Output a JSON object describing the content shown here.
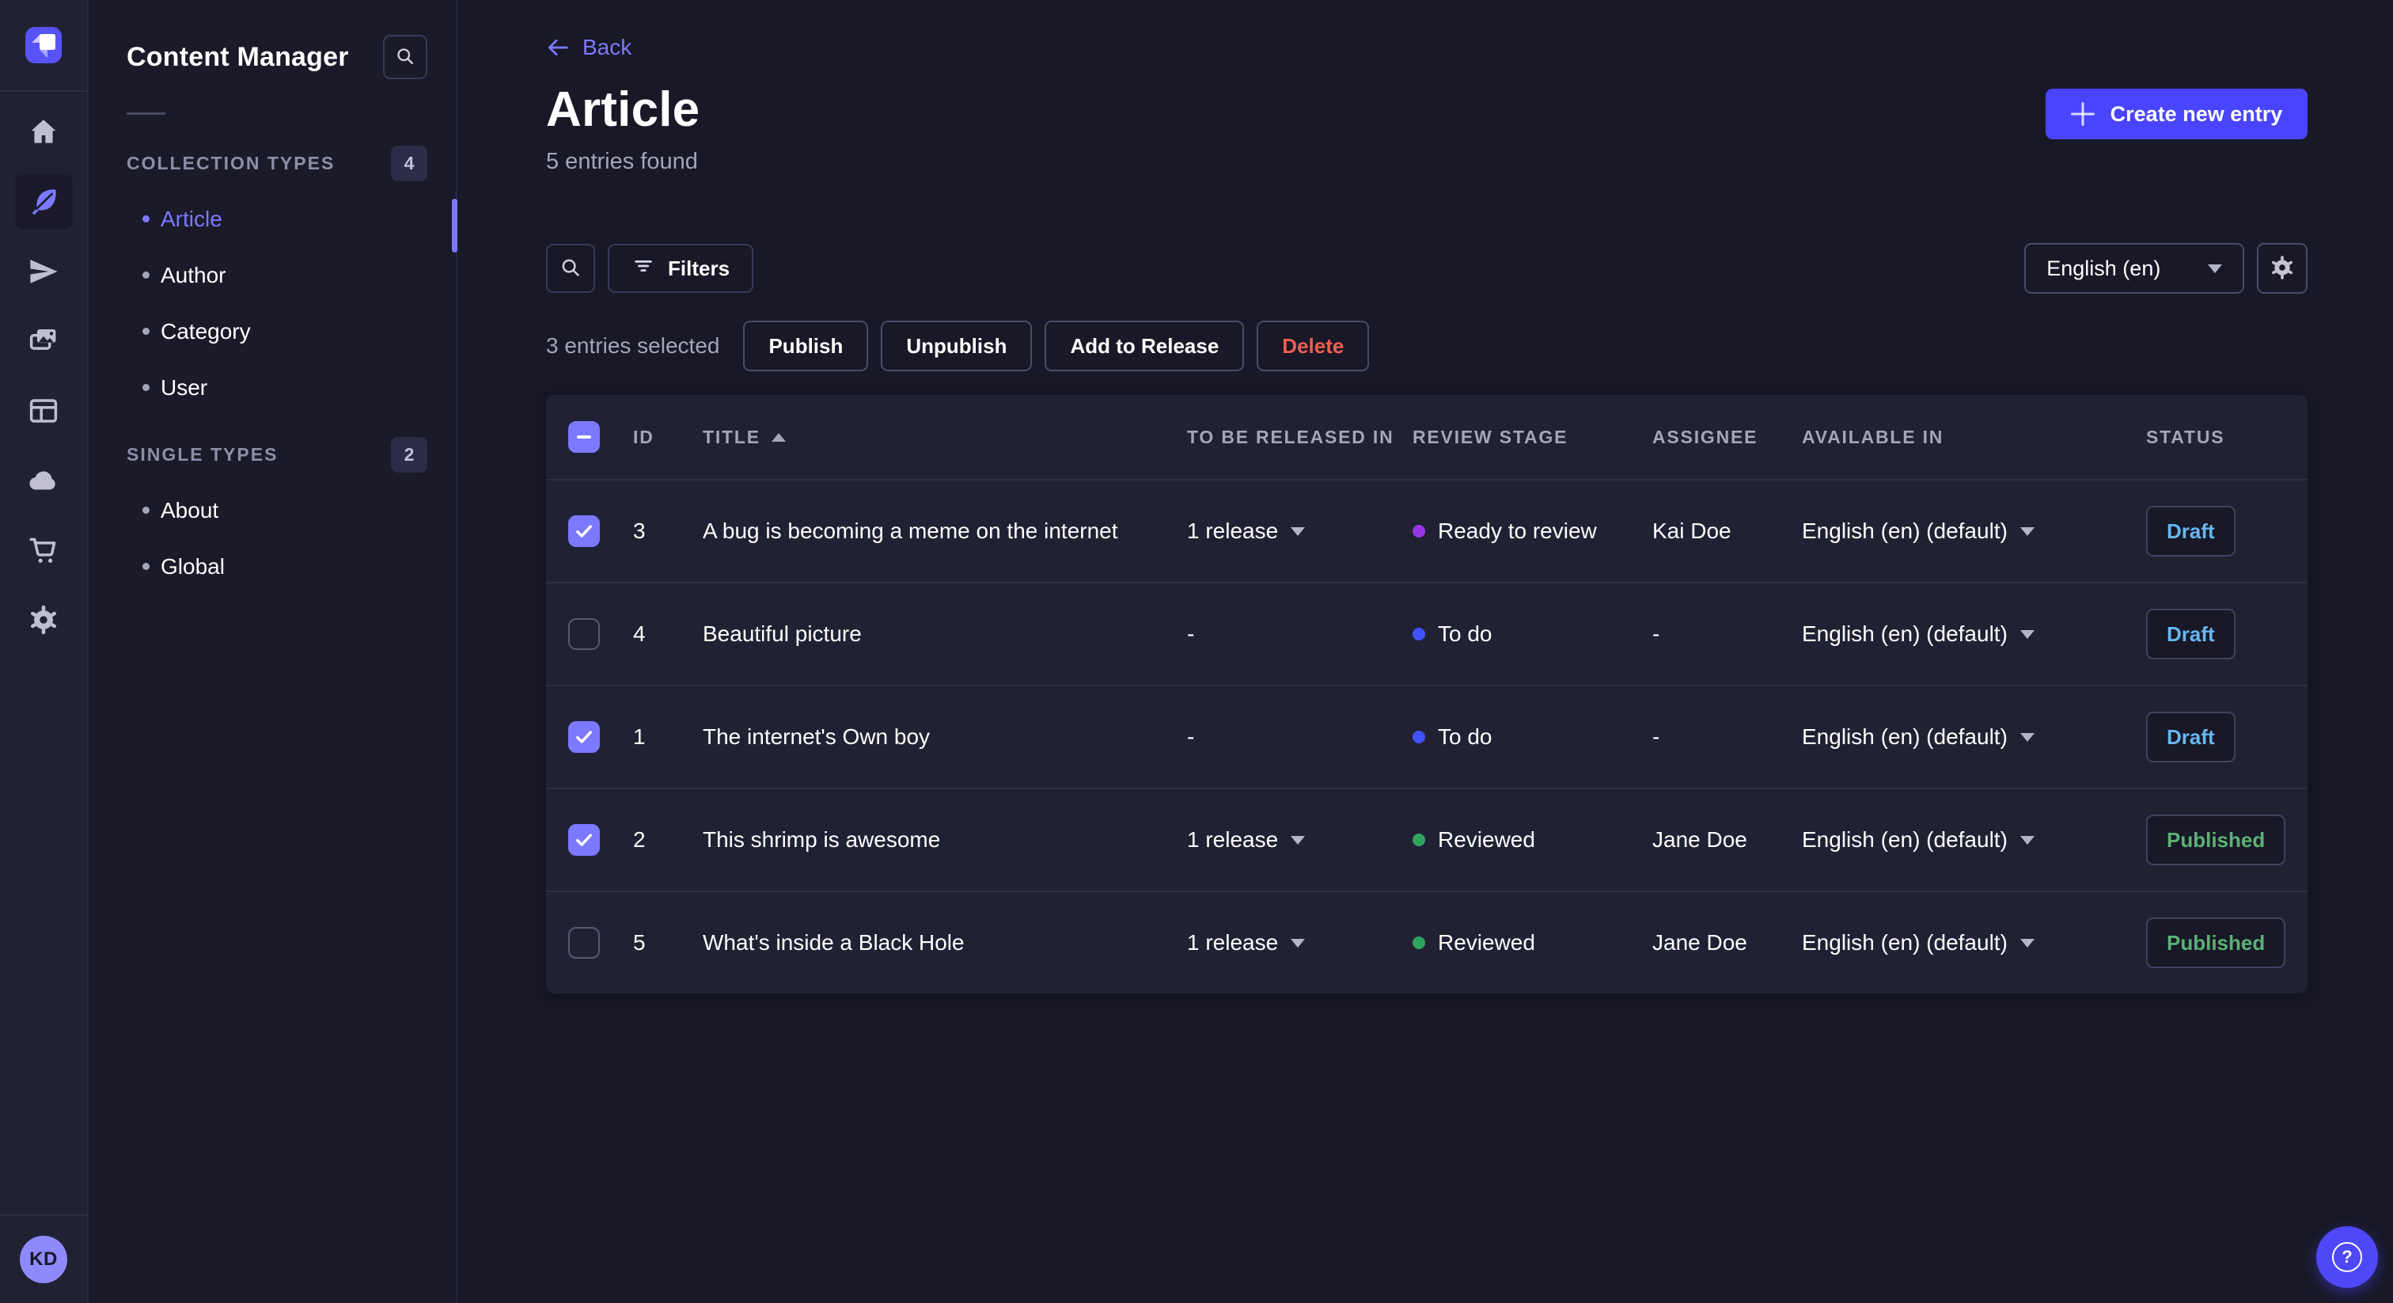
{
  "rail": {
    "items": [
      {
        "name": "home",
        "active": false
      },
      {
        "name": "content-manager",
        "active": true
      },
      {
        "name": "releases",
        "active": false
      },
      {
        "name": "media-library",
        "active": false
      },
      {
        "name": "content-type-builder",
        "active": false
      },
      {
        "name": "cloud",
        "active": false
      },
      {
        "name": "marketplace",
        "active": false
      },
      {
        "name": "settings",
        "active": false
      }
    ],
    "avatar_initials": "KD"
  },
  "sidebar": {
    "title": "Content Manager",
    "sections": [
      {
        "label": "COLLECTION TYPES",
        "count": "4",
        "items": [
          {
            "label": "Article",
            "active": true
          },
          {
            "label": "Author",
            "active": false
          },
          {
            "label": "Category",
            "active": false
          },
          {
            "label": "User",
            "active": false
          }
        ]
      },
      {
        "label": "SINGLE TYPES",
        "count": "2",
        "items": [
          {
            "label": "About",
            "active": false
          },
          {
            "label": "Global",
            "active": false
          }
        ]
      }
    ]
  },
  "header": {
    "back_label": "Back",
    "title": "Article",
    "subtitle": "5 entries found",
    "create_label": "Create new entry"
  },
  "toolbar": {
    "filters_label": "Filters",
    "locale_value": "English (en)"
  },
  "selection": {
    "count_text": "3 entries selected",
    "publish_label": "Publish",
    "unpublish_label": "Unpublish",
    "add_to_release_label": "Add to Release",
    "delete_label": "Delete"
  },
  "table": {
    "select_all_state": "indeterminate",
    "sort": {
      "column": "TITLE",
      "direction": "asc"
    },
    "headers": {
      "id": "ID",
      "title": "TITLE",
      "released": "TO BE RELEASED IN",
      "review": "REVIEW STAGE",
      "assignee": "ASSIGNEE",
      "available": "AVAILABLE IN",
      "status": "STATUS"
    },
    "rows": [
      {
        "checked": true,
        "id": "3",
        "title": "A bug is becoming a meme on the internet",
        "released_in": "1 release",
        "has_release_dropdown": true,
        "review_stage": "Ready to review",
        "review_color": "#9736e8",
        "assignee": "Kai Doe",
        "available_in": "English (en) (default)",
        "status": "Draft",
        "status_color": "#66b7f1"
      },
      {
        "checked": false,
        "id": "4",
        "title": "Beautiful picture",
        "released_in": "-",
        "has_release_dropdown": false,
        "review_stage": "To do",
        "review_color": "#4152ff",
        "assignee": "-",
        "available_in": "English (en) (default)",
        "status": "Draft",
        "status_color": "#66b7f1"
      },
      {
        "checked": true,
        "id": "1",
        "title": "The internet's Own boy",
        "released_in": "-",
        "has_release_dropdown": false,
        "review_stage": "To do",
        "review_color": "#4152ff",
        "assignee": "-",
        "available_in": "English (en) (default)",
        "status": "Draft",
        "status_color": "#66b7f1"
      },
      {
        "checked": true,
        "id": "2",
        "title": "This shrimp is awesome",
        "released_in": "1 release",
        "has_release_dropdown": true,
        "review_stage": "Reviewed",
        "review_color": "#2fa45e",
        "assignee": "Jane Doe",
        "available_in": "English (en) (default)",
        "status": "Published",
        "status_color": "#5cb176"
      },
      {
        "checked": false,
        "id": "5",
        "title": "What's inside a Black Hole",
        "released_in": "1 release",
        "has_release_dropdown": true,
        "review_stage": "Reviewed",
        "review_color": "#2fa45e",
        "assignee": "Jane Doe",
        "available_in": "English (en) (default)",
        "status": "Published",
        "status_color": "#5cb176"
      }
    ]
  },
  "fab": {
    "glyph": "?"
  },
  "colors": {
    "primary": "#4945ff",
    "accent": "#7b79ff",
    "draft": "#66b7f1",
    "published": "#5cb176",
    "danger": "#ee5e52"
  }
}
